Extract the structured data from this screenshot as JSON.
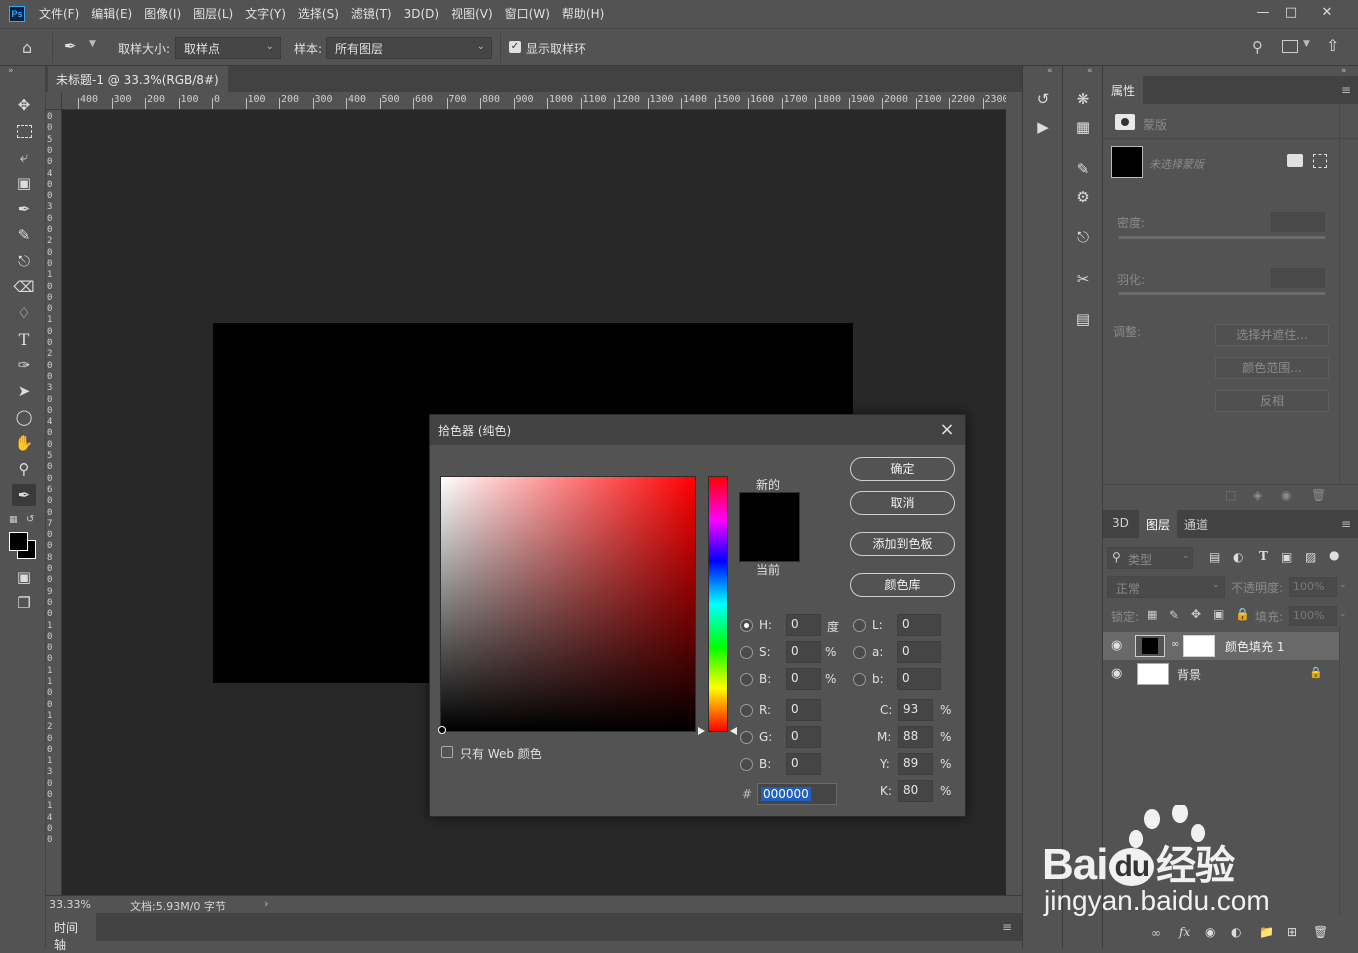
{
  "app": {
    "logo": "Ps",
    "menu": [
      "文件(F)",
      "编辑(E)",
      "图像(I)",
      "图层(L)",
      "文字(Y)",
      "选择(S)",
      "滤镜(T)",
      "3D(D)",
      "视图(V)",
      "窗口(W)",
      "帮助(H)"
    ],
    "window_controls": [
      "minimize-icon",
      "maximize-icon",
      "close-icon"
    ]
  },
  "options_bar": {
    "sample_size_label": "取样大小:",
    "sample_size_value": "取样点",
    "sample_label": "样本:",
    "sample_value": "所有图层",
    "show_ring_label": "显示取样环",
    "show_ring_checked": true
  },
  "document": {
    "tab_title": "未标题-1 @ 33.3%(RGB/8#)",
    "zoom": "33.33%",
    "doc_info": "文档:5.93M/0 字节",
    "ruler_top": [
      "400",
      "300",
      "200",
      "100",
      "0",
      "100",
      "200",
      "300",
      "400",
      "500",
      "600",
      "700",
      "800",
      "900",
      "1000",
      "1100",
      "1200",
      "1300",
      "1400",
      "1500",
      "1600",
      "1700",
      "1800",
      "1900",
      "2000",
      "2100",
      "2200",
      "2300"
    ],
    "ruler_left_digits": [
      "0",
      "0",
      "5",
      "0",
      "0",
      "4",
      "0",
      "0",
      "3",
      "0",
      "0",
      "2",
      "0",
      "0",
      "1",
      "0",
      "0",
      "0",
      "1",
      "0",
      "0",
      "2",
      "0",
      "0",
      "3",
      "0",
      "0",
      "4",
      "0",
      "0",
      "5",
      "0",
      "0",
      "6",
      "0",
      "0",
      "7",
      "0",
      "0",
      "8",
      "0",
      "0",
      "9",
      "0",
      "0",
      "1",
      "0",
      "0",
      "0",
      "1",
      "1",
      "0",
      "0",
      "1",
      "2",
      "0",
      "0",
      "1",
      "3",
      "0",
      "0",
      "1",
      "4",
      "0",
      "0"
    ],
    "canvas_fill": "#000000"
  },
  "timeline": {
    "tab": "时间轴"
  },
  "properties": {
    "tab": "属性",
    "section": "蒙版",
    "mask_label": "未选择蒙版",
    "density_label": "密度:",
    "feather_label": "羽化:",
    "adjust_label": "调整:",
    "select_mask_btn": "选择并遮住...",
    "color_range_btn": "颜色范围...",
    "invert_btn": "反相"
  },
  "layers": {
    "tabs": [
      "3D",
      "图层",
      "通道"
    ],
    "active_tab": "图层",
    "filter_placeholder": "类型",
    "blend_mode": "正常",
    "opacity_label": "不透明度:",
    "opacity_value": "100%",
    "lock_label": "锁定:",
    "fill_label": "填充:",
    "fill_value": "100%",
    "items": [
      {
        "name": "颜色填充 1",
        "selected": true
      },
      {
        "name": "背景",
        "selected": false
      }
    ]
  },
  "color_picker": {
    "title": "拾色器 (纯色)",
    "new_label": "新的",
    "current_label": "当前",
    "ok": "确定",
    "cancel": "取消",
    "add_swatch": "添加到色板",
    "color_library": "颜色库",
    "web_only_label": "只有 Web 颜色",
    "hsb": [
      {
        "key": "H:",
        "value": "0",
        "unit": "度",
        "selected": true
      },
      {
        "key": "S:",
        "value": "0",
        "unit": "%",
        "selected": false
      },
      {
        "key": "B:",
        "value": "0",
        "unit": "%",
        "selected": false
      }
    ],
    "rgb": [
      {
        "key": "R:",
        "value": "0"
      },
      {
        "key": "G:",
        "value": "0"
      },
      {
        "key": "B:",
        "value": "0"
      }
    ],
    "lab": [
      {
        "key": "L:",
        "value": "0"
      },
      {
        "key": "a:",
        "value": "0"
      },
      {
        "key": "b:",
        "value": "0"
      }
    ],
    "cmyk": [
      {
        "key": "C:",
        "value": "93",
        "unit": "%"
      },
      {
        "key": "M:",
        "value": "88",
        "unit": "%"
      },
      {
        "key": "Y:",
        "value": "89",
        "unit": "%"
      },
      {
        "key": "K:",
        "value": "80",
        "unit": "%"
      }
    ],
    "hex_label": "#",
    "hex_value": "000000",
    "new_color": "#000000",
    "current_color": "#000000"
  },
  "watermark": {
    "brand": "Bai",
    "brand2": "du",
    "cn": "经验",
    "url": "jingyan.baidu.com"
  }
}
